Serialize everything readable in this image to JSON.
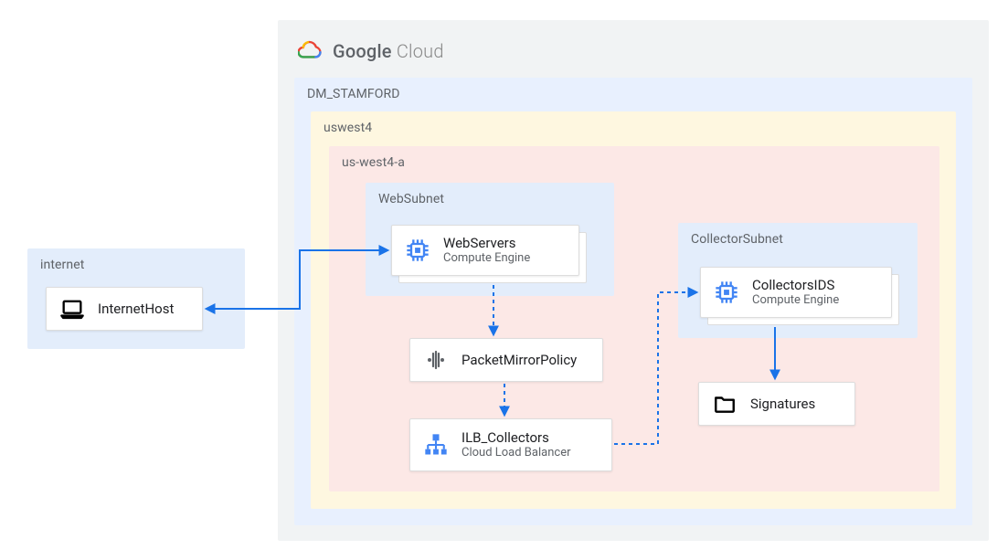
{
  "brand": {
    "strong": "Google",
    "light": "Cloud"
  },
  "internet": {
    "label": "internet",
    "host": {
      "title": "InternetHost"
    }
  },
  "project": {
    "label": "DM_STAMFORD",
    "region": {
      "label": "uswest4",
      "zone": {
        "label": "us-west4-a",
        "websubnet": {
          "label": "WebSubnet",
          "webservers": {
            "title": "WebServers",
            "subtitle": "Compute Engine"
          }
        },
        "packetmirror": {
          "title": "PacketMirrorPolicy"
        },
        "ilb": {
          "title": "ILB_Collectors",
          "subtitle": "Cloud Load Balancer"
        },
        "collectorsubnet": {
          "label": "CollectorSubnet",
          "collectors": {
            "title": "CollectorsIDS",
            "subtitle": "Compute Engine"
          }
        },
        "signatures": {
          "title": "Signatures"
        }
      }
    }
  },
  "colors": {
    "outer_gray": "#f1f3f4",
    "project_blue": "#e8f0fe",
    "region_yellow": "#fef7e0",
    "zone_pink": "#fce8e6",
    "subnet_blue": "#e3edfb",
    "arrow_blue": "#1a73e8"
  }
}
